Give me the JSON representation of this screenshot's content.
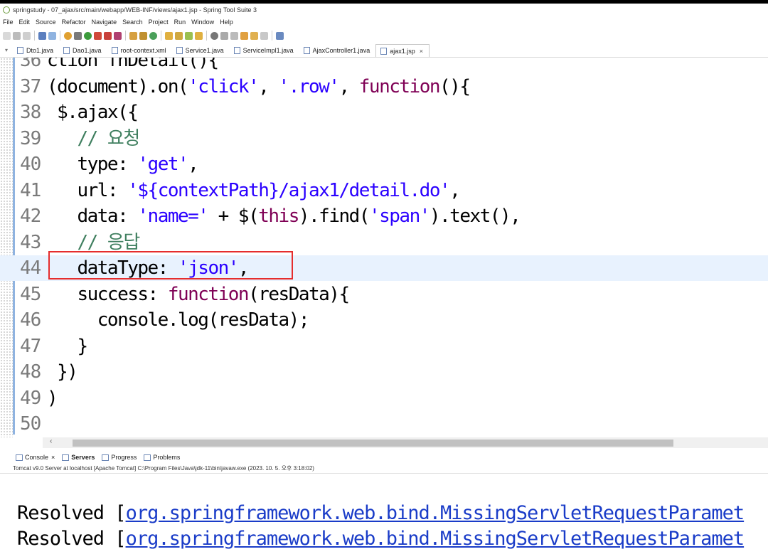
{
  "window": {
    "title": "springstudy - 07_ajax/src/main/webapp/WEB-INF/views/ajax1.jsp - Spring Tool Suite 3"
  },
  "menu": [
    "File",
    "Edit",
    "Source",
    "Refactor",
    "Navigate",
    "Search",
    "Project",
    "Run",
    "Window",
    "Help"
  ],
  "tabs": [
    {
      "label": "Dto1.java"
    },
    {
      "label": "Dao1.java"
    },
    {
      "label": "root-context.xml"
    },
    {
      "label": "Service1.java"
    },
    {
      "label": "ServiceImpl1.java"
    },
    {
      "label": "AjaxController1.java"
    },
    {
      "label": "ajax1.jsp",
      "active": true,
      "close": "×"
    }
  ],
  "editor": {
    "current_line": "44",
    "lines": [
      {
        "no": "36",
        "text": "ction fnDetail(){"
      },
      {
        "no": "37",
        "text": "(document).on('click', '.row', function(){"
      },
      {
        "no": "38",
        "text": " $.ajax({"
      },
      {
        "no": "39",
        "text": "   // 요청"
      },
      {
        "no": "40",
        "text": "   type: 'get',"
      },
      {
        "no": "41",
        "text": "   url: '${contextPath}/ajax1/detail.do',"
      },
      {
        "no": "42",
        "text": "   data: 'name=' + $(this).find('span').text(),"
      },
      {
        "no": "43",
        "text": "   // 응답"
      },
      {
        "no": "44",
        "text": "   dataType: 'json',"
      },
      {
        "no": "45",
        "text": "   success: function(resData){"
      },
      {
        "no": "46",
        "text": "     console.log(resData);"
      },
      {
        "no": "47",
        "text": "   }"
      },
      {
        "no": "48",
        "text": " })"
      },
      {
        "no": "49",
        "text": ")"
      },
      {
        "no": "50",
        "text": ""
      }
    ]
  },
  "console": {
    "tabs": [
      {
        "label": "Console",
        "close": "×"
      },
      {
        "label": "Servers"
      },
      {
        "label": "Progress"
      },
      {
        "label": "Problems"
      }
    ],
    "header": "Tomcat v9.0 Server at localhost [Apache Tomcat] C:\\Program Files\\Java\\jdk-11\\bin\\javaw.exe  (2023. 10. 5. 오후 3:18:02)",
    "output": [
      {
        "prefix": "Resolved [",
        "link": "org.springframework.web.bind.MissingServletRequestParamet"
      },
      {
        "prefix": "Resolved [",
        "link": "org.springframework.web.bind.MissingServletRequestParamet"
      }
    ]
  },
  "colors": {
    "highlight_box": "#e52d2d",
    "keyword": "#7f0055",
    "string": "#2a00ff",
    "comment": "#3f7f5f"
  }
}
